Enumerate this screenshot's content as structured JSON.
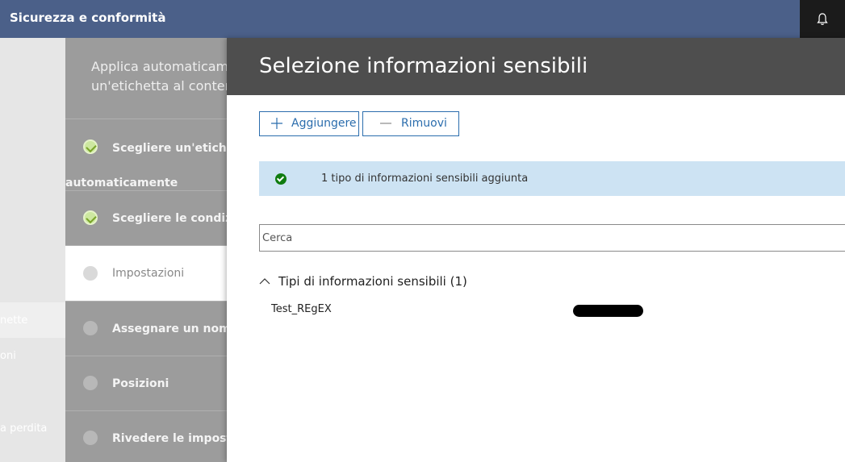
{
  "app": {
    "title": "Sicurezza e conformità"
  },
  "leftnav": {
    "items": [
      {
        "label": "nette"
      },
      {
        "label": "oni"
      },
      {
        "label": "a perdita"
      }
    ]
  },
  "wizard": {
    "intro_line1": "Applica automaticamente",
    "intro_line2": "un'etichetta al contenuto",
    "steps": [
      {
        "label": "Scegliere un'etichetta",
        "sublabel": "automaticamente",
        "status": "done"
      },
      {
        "label": "Scegliere le condizioni",
        "status": "done"
      },
      {
        "label": "Impostazioni",
        "status": "current"
      },
      {
        "label": "Assegnare un nome a",
        "status": "pending"
      },
      {
        "label": "Posizioni",
        "status": "pending"
      },
      {
        "label": "Rivedere le impostazioni",
        "status": "pending"
      }
    ]
  },
  "panel": {
    "title": "Selezione informazioni sensibili",
    "add_label": "Aggiungere",
    "remove_label": "Rimuovi",
    "banner_message": "1 tipo di informazioni sensibili aggiunta",
    "search_placeholder": "Cerca",
    "group_label": "Tipi di informazioni sensibili (1)",
    "items": [
      {
        "name": "Test_REgEX"
      }
    ]
  },
  "colors": {
    "topbar": "#4b6089",
    "accent": "#2b6dad",
    "banner": "#cde3f3",
    "success": "#107c10"
  }
}
